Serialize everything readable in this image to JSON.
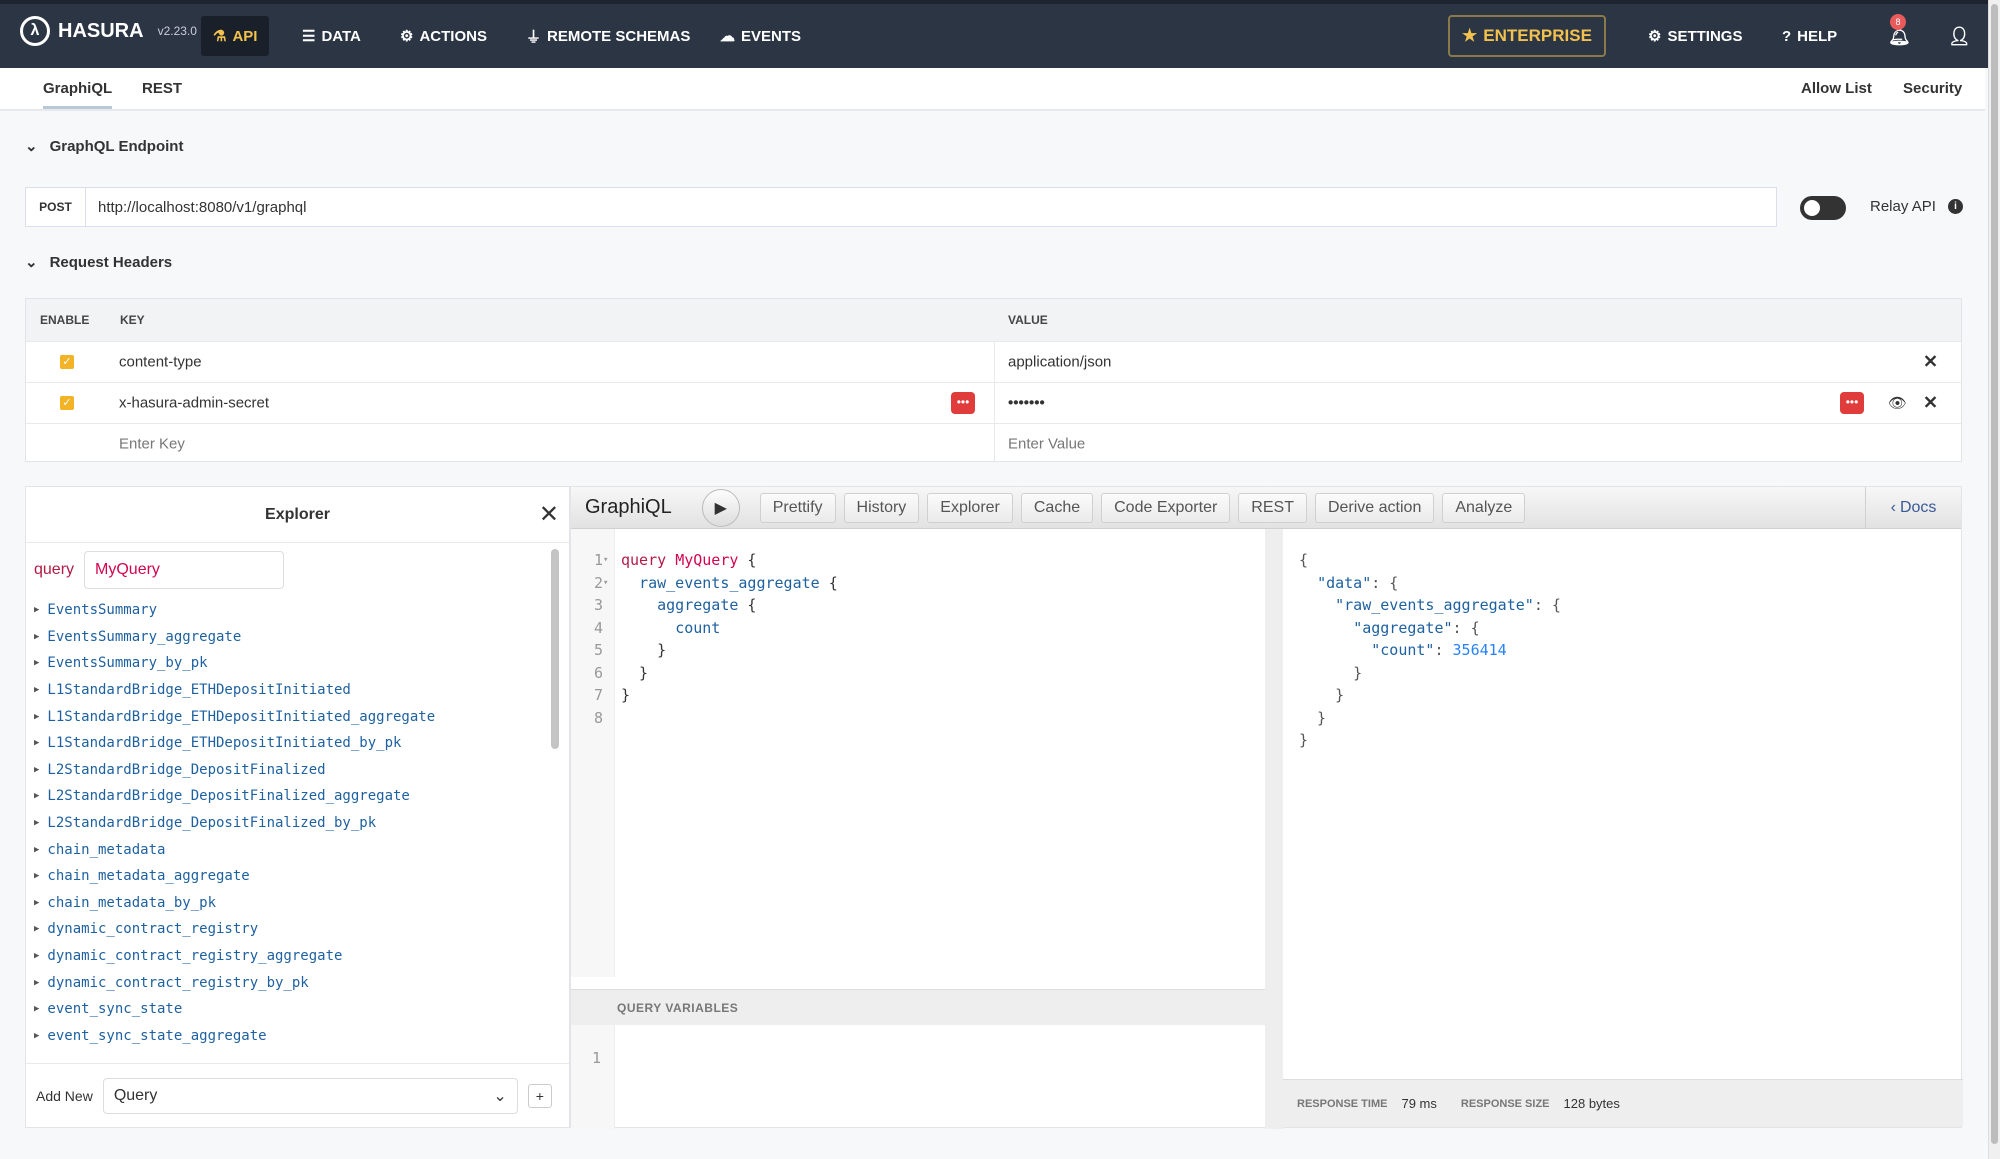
{
  "topbar": {
    "brand": "HASURA",
    "version": "v2.23.0",
    "nav": [
      {
        "label": "API",
        "icon": "flask-icon"
      },
      {
        "label": "DATA",
        "icon": "database-icon"
      },
      {
        "label": "ACTIONS",
        "icon": "cogs-icon"
      },
      {
        "label": "REMOTE SCHEMAS",
        "icon": "plug-icon"
      },
      {
        "label": "EVENTS",
        "icon": "cloud-icon"
      }
    ],
    "enterprise": "ENTERPRISE",
    "settings": "SETTINGS",
    "help": "HELP",
    "notifications": "8",
    "accent": "#f2c14e"
  },
  "subtabs": {
    "items": [
      "GraphiQL",
      "REST"
    ],
    "right": [
      "Allow List",
      "Security"
    ]
  },
  "endpoint": {
    "section": "GraphQL Endpoint",
    "method": "POST",
    "url": "http://localhost:8080/v1/graphql",
    "relay_label": "Relay API",
    "relay_on": false
  },
  "headers": {
    "section": "Request Headers",
    "columns": [
      "ENABLE",
      "KEY",
      "VALUE"
    ],
    "rows": [
      {
        "enabled": true,
        "key": "content-type",
        "value": "application/json"
      },
      {
        "enabled": true,
        "key": "x-hasura-admin-secret",
        "value": "•••••••"
      }
    ],
    "key_placeholder": "Enter Key",
    "value_placeholder": "Enter Value"
  },
  "explorer": {
    "title": "Explorer",
    "op_type": "query",
    "op_name": "MyQuery",
    "items": [
      "EventsSummary",
      "EventsSummary_aggregate",
      "EventsSummary_by_pk",
      "L1StandardBridge_ETHDepositInitiated",
      "L1StandardBridge_ETHDepositInitiated_aggregate",
      "L1StandardBridge_ETHDepositInitiated_by_pk",
      "L2StandardBridge_DepositFinalized",
      "L2StandardBridge_DepositFinalized_aggregate",
      "L2StandardBridge_DepositFinalized_by_pk",
      "chain_metadata",
      "chain_metadata_aggregate",
      "chain_metadata_by_pk",
      "dynamic_contract_registry",
      "dynamic_contract_registry_aggregate",
      "dynamic_contract_registry_by_pk",
      "event_sync_state",
      "event_sync_state_aggregate"
    ],
    "add_new_label": "Add New",
    "add_new_value": "Query"
  },
  "graphiql": {
    "title": "GraphiQL",
    "buttons": [
      "Prettify",
      "History",
      "Explorer",
      "Cache",
      "Code Exporter",
      "REST",
      "Derive action",
      "Analyze"
    ],
    "docs": "Docs",
    "query_lines": [
      "query MyQuery {",
      "  raw_events_aggregate {",
      "    aggregate {",
      "      count",
      "    }",
      "  }",
      "}",
      ""
    ],
    "variables_label": "QUERY VARIABLES",
    "variables_lines": [
      ""
    ],
    "result": {
      "count": "356414"
    },
    "response_time_label": "RESPONSE TIME",
    "response_time": "79 ms",
    "response_size_label": "RESPONSE SIZE",
    "response_size": "128 bytes"
  }
}
